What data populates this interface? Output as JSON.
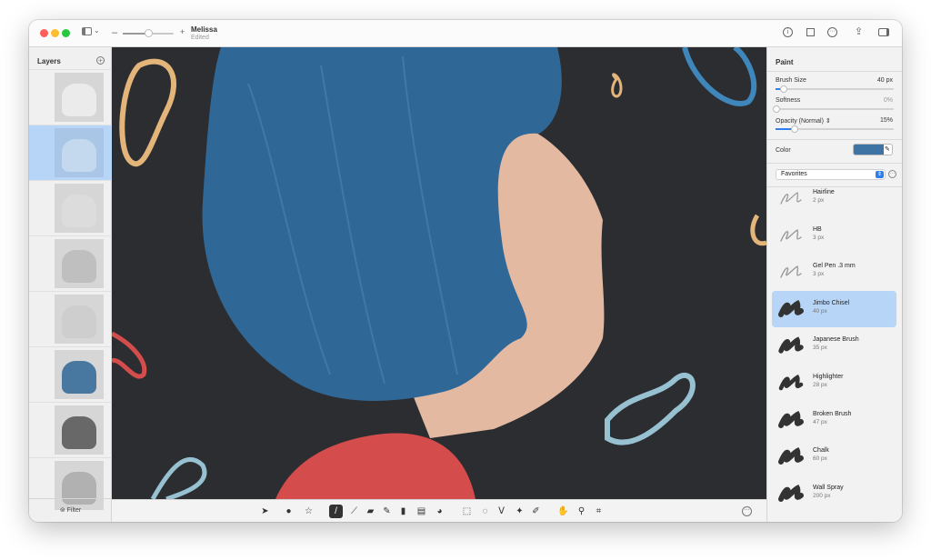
{
  "window": {
    "title": "Melissa",
    "status": "Edited",
    "zoom_fraction": 0.5
  },
  "layers": {
    "title": "Layers",
    "count": 8,
    "selected_index": 1,
    "filter_label": "Filter"
  },
  "paint": {
    "title": "Paint",
    "brush_size": {
      "label": "Brush Size",
      "value": "40 px",
      "fraction": 0.06
    },
    "softness": {
      "label": "Softness",
      "value": "0%",
      "fraction": 0
    },
    "opacity": {
      "label": "Opacity (Normal)",
      "value": "15%",
      "fraction": 0.15
    },
    "color": {
      "label": "Color",
      "value": "#3d74a3"
    },
    "preset_select": "Favorites",
    "brushes": [
      {
        "name": "Hairline",
        "size": "2 px"
      },
      {
        "name": "HB",
        "size": "3 px"
      },
      {
        "name": "Gel Pen .3 mm",
        "size": "3 px"
      },
      {
        "name": "Jimbo Chisel",
        "size": "40 px",
        "selected": true
      },
      {
        "name": "Japanese Brush",
        "size": "35 px"
      },
      {
        "name": "Highlighter",
        "size": "28 px"
      },
      {
        "name": "Broken Brush",
        "size": "47 px"
      },
      {
        "name": "Chalk",
        "size": "60 px"
      },
      {
        "name": "Wall Spray",
        "size": "200 px"
      }
    ]
  },
  "toolbar": {
    "tools": [
      "arrow-icon",
      "color-adjust-icon",
      "effects-star-icon",
      "paint-brush-icon",
      "brush-icon",
      "eraser-icon",
      "eyedropper-icon",
      "paint-bucket-icon",
      "gradient-icon",
      "clone-icon",
      "rect-select-icon",
      "ellipse-select-icon",
      "lasso-icon",
      "magic-wand-icon",
      "quick-select-icon",
      "hand-icon",
      "zoom-icon",
      "crop-icon"
    ],
    "active": "paint-brush-icon"
  },
  "colors": {
    "canvas_bg": "#2b2d31",
    "hair": "#2f6796",
    "skin": "#e4b9a2",
    "shirt": "#d44c4c",
    "accent": "#2f7ff0"
  }
}
